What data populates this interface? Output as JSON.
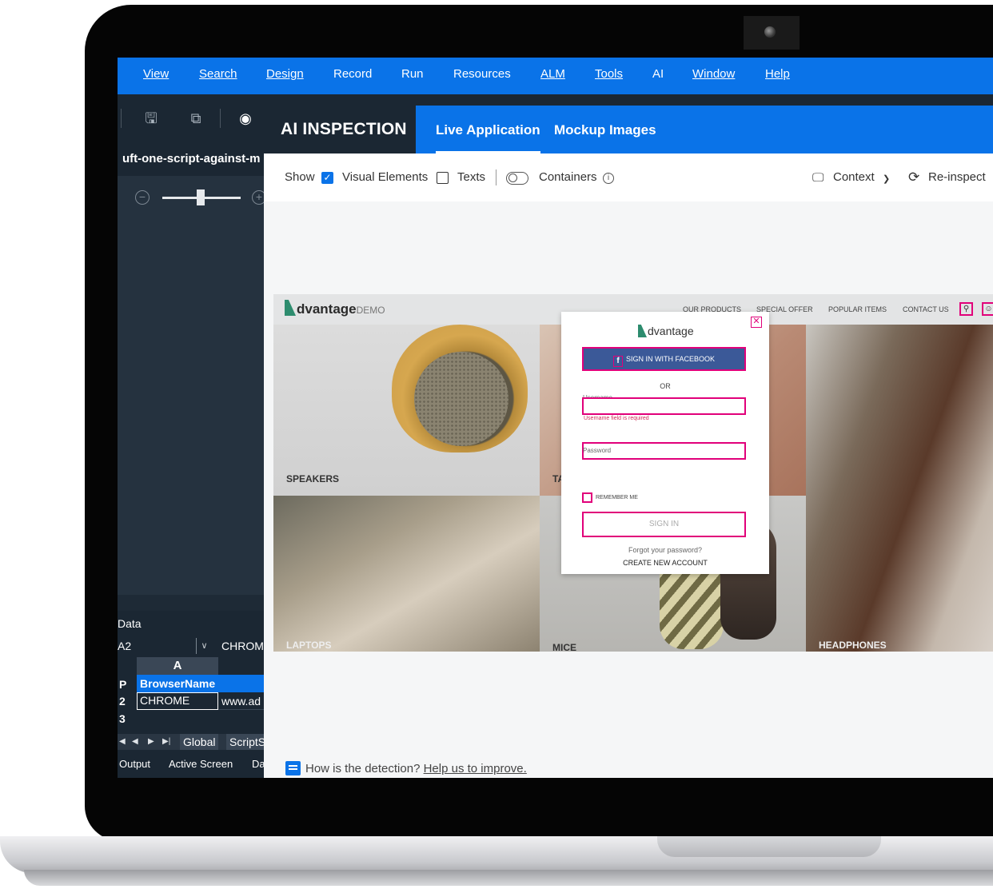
{
  "menu": [
    "View",
    "Search",
    "Design",
    "Record",
    "Run",
    "Resources",
    "ALM",
    "Tools",
    "AI",
    "Window",
    "Help"
  ],
  "document_tab": "uft-one-script-against-m",
  "data_panel": {
    "title": "Data",
    "cell_ref": "A2",
    "cell_value": "CHROME",
    "column_header": "A",
    "row_labels": [
      "P",
      "2",
      "3"
    ],
    "header_cell": "BrowserName",
    "a2": "CHROME",
    "b2": "www.ad",
    "sheet_tabs": [
      "Global",
      "ScriptS"
    ]
  },
  "bottom_tabs": [
    "Output",
    "Active Screen",
    "Da"
  ],
  "ai_inspection": {
    "title": "AI INSPECTION",
    "tabs": [
      "Live Application",
      "Mockup Images"
    ],
    "active_tab": "Live Application",
    "options": {
      "show_label": "Show",
      "visual_elements_label": "Visual Elements",
      "visual_elements_checked": true,
      "texts_label": "Texts",
      "texts_checked": false,
      "containers_label": "Containers",
      "containers_on": false,
      "info_glyph": "i",
      "context_label": "Context",
      "reinspect_label": "Re-inspect"
    },
    "footer_question": "How is the detection?",
    "footer_link": "Help us to improve."
  },
  "app": {
    "logo_text": "dvantage",
    "logo_demo": "DEMO",
    "nav_links": [
      "OUR PRODUCTS",
      "SPECIAL OFFER",
      "POPULAR ITEMS",
      "CONTACT US"
    ],
    "tiles": [
      "SPEAKERS",
      "TA",
      "LAPTOPS",
      "MICE",
      "HEADPHONES"
    ],
    "modal": {
      "logo": "dvantage",
      "facebook_button": "SIGN IN WITH FACEBOOK",
      "or_text": "OR",
      "username_label": "Username",
      "username_error": "Username field is required",
      "password_label": "Password",
      "remember_label": "REMEMBER ME",
      "signin_button": "SIGN IN",
      "forgot_link": "Forgot your password?",
      "create_link": "CREATE NEW ACCOUNT"
    }
  },
  "colors": {
    "accent": "#0a73e8",
    "dark_panel": "#1b2733",
    "highlight": "#e1007a"
  }
}
